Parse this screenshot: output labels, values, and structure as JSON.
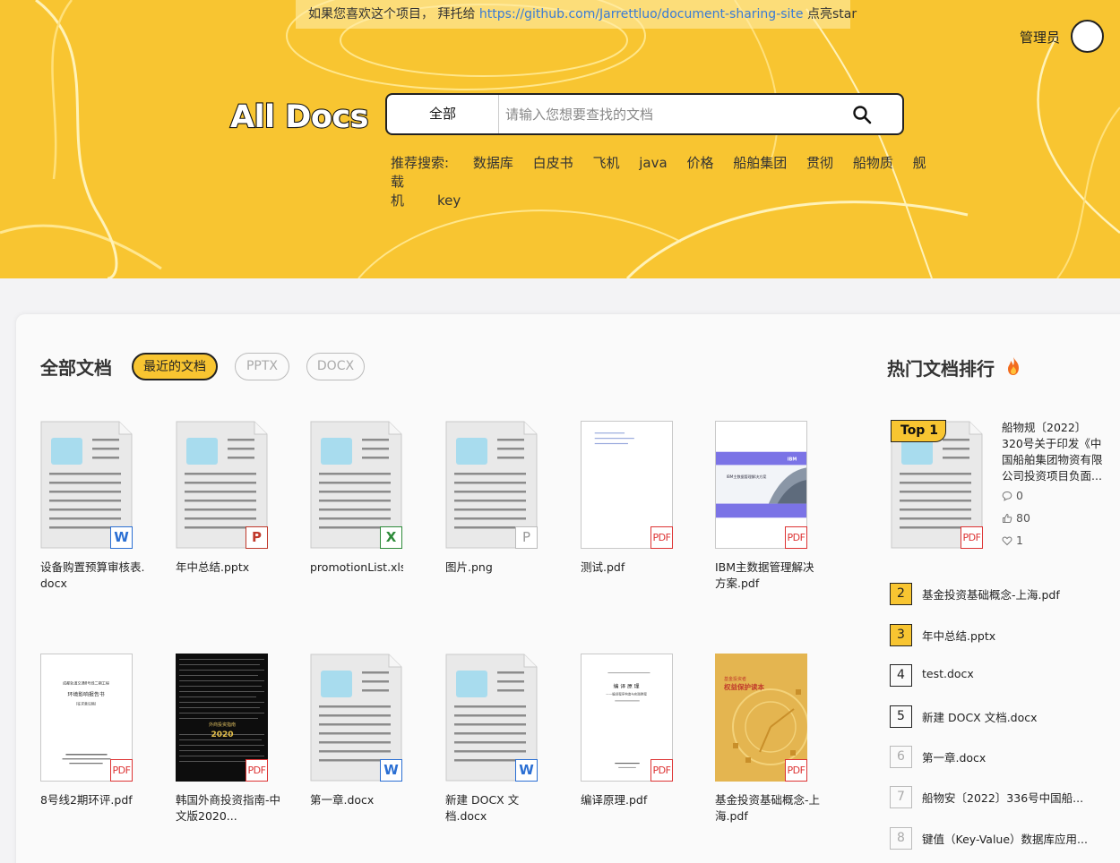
{
  "notice": {
    "prefix": "如果您喜欢这个项目， 拜托给 ",
    "link": "https://github.com/Jarrettluo/document-sharing-site",
    "suffix": " 点亮star"
  },
  "header": {
    "admin_label": "管理员",
    "logo_text": "All Docs"
  },
  "search": {
    "scope": "全部",
    "placeholder": "请输入您想要查找的文档"
  },
  "recommend": {
    "label": "推荐搜索:",
    "tags": [
      "数据库",
      "白皮书",
      "飞机",
      "java",
      "价格",
      "船舶集团",
      "贯彻",
      "船物质",
      "舰载",
      "机",
      "key"
    ]
  },
  "documents": {
    "title": "全部文档",
    "filters": [
      "最近的文档",
      "PPTX",
      "DOCX"
    ],
    "items": [
      {
        "name": "设备购置预算审核表.docx",
        "type": "W"
      },
      {
        "name": "年中总结.pptx",
        "type": "P"
      },
      {
        "name": "promotionList.xlsx",
        "type": "X"
      },
      {
        "name": "图片.png",
        "type": "P"
      },
      {
        "name": "测试.pdf",
        "type": "PDF"
      },
      {
        "name": "IBM主数据管理解决方案.pdf",
        "type": "PDF"
      },
      {
        "name": "8号线2期环评.pdf",
        "type": "PDF"
      },
      {
        "name": "韩国外商投资指南-中文版2020...",
        "type": "PDF"
      },
      {
        "name": "第一章.docx",
        "type": "W"
      },
      {
        "name": "新建 DOCX 文档.docx",
        "type": "W"
      },
      {
        "name": "编译原理.pdf",
        "type": "PDF"
      },
      {
        "name": "基金投资基础概念-上海.pdf",
        "type": "PDF"
      }
    ],
    "thumb_text": {
      "ibm_logo": "IBM",
      "ibm_title": "IBM主数据管理解决方案",
      "eia_org": "成都轨道交通8号线二期工程",
      "eia_title": "环境影响报告书",
      "eia_sub": "(征求意见稿)",
      "korea_title": "外商投资指南",
      "korea_year": "2020",
      "compiler_title": "编 译 原 理",
      "compiler_sub": "——编译程序构造与实践教程",
      "fund_title": "基金投资者",
      "fund_sub": "权益保护读本"
    }
  },
  "hot": {
    "title": "热门文档排行",
    "top1": {
      "label": "Top 1",
      "title": "船物规〔2022〕320号关于印发《中国船舶集团物资有限公司投资项目负面...",
      "type": "PDF",
      "comments": "0",
      "likes": "80",
      "favorites": "1"
    },
    "ranks": [
      {
        "num": "2",
        "name": "基金投资基础概念-上海.pdf"
      },
      {
        "num": "3",
        "name": "年中总结.pptx"
      },
      {
        "num": "4",
        "name": "test.docx"
      },
      {
        "num": "5",
        "name": "新建 DOCX 文档.docx"
      },
      {
        "num": "6",
        "name": "第一章.docx"
      },
      {
        "num": "7",
        "name": "船物安〔2022〕336号中国船..."
      },
      {
        "num": "8",
        "name": "键值（Key-Value）数据库应用..."
      }
    ]
  },
  "colors": {
    "accent": "#f8c531",
    "background": "#f3f3f5",
    "word": "#2b6fd3",
    "pdf": "#d33333",
    "excel": "#2e8b3a"
  }
}
